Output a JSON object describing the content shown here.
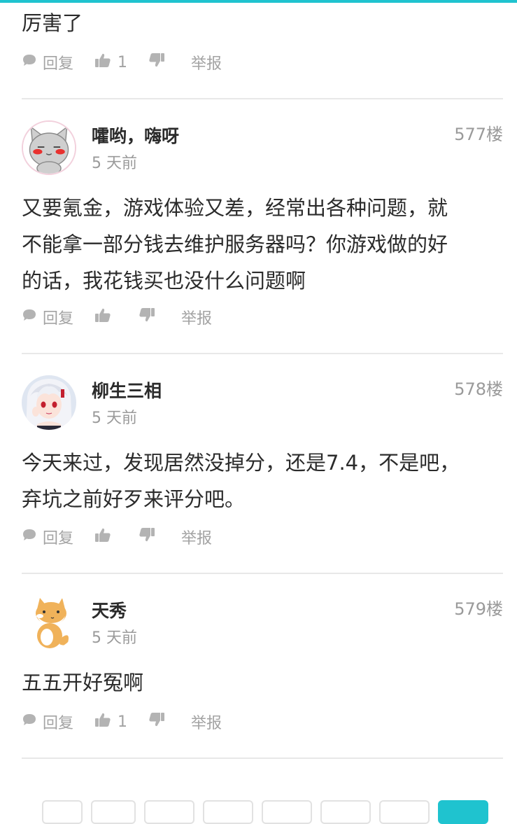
{
  "colors": {
    "accent": "#1fc3cf",
    "text": "#2b2b2b",
    "muted": "#a3a3a3",
    "divider": "#e8e8e8"
  },
  "actions": {
    "reply_label": "回复",
    "report_label": "举报"
  },
  "first_comment": {
    "body": "厉害了",
    "likes": "1"
  },
  "comments": [
    {
      "author": "嚯哟，嗨呀",
      "time": "5 天前",
      "floor": "577楼",
      "avatar_icon": "gray-cat-avatar-icon",
      "lines": [
        "又要氪金，游戏体验又差，经常出各种问题，就",
        "不能拿一部分钱去维护服务器吗？你游戏做的好",
        "的话，我花钱买也没什么问题啊"
      ],
      "likes": ""
    },
    {
      "author": "柳生三相",
      "time": "5 天前",
      "floor": "578楼",
      "avatar_icon": "anime-girl-avatar-icon",
      "lines": [
        "今天来过，发现居然没掉分，还是7.4，不是吧，",
        "弃坑之前好歹来评分吧。"
      ],
      "likes": ""
    },
    {
      "author": "天秀",
      "time": "5 天前",
      "floor": "579楼",
      "avatar_icon": "shiba-dog-avatar-icon",
      "lines": [
        "五五开好冤啊"
      ],
      "likes": "1"
    }
  ],
  "pagination": {
    "page_count": 8,
    "active_index": 7
  }
}
